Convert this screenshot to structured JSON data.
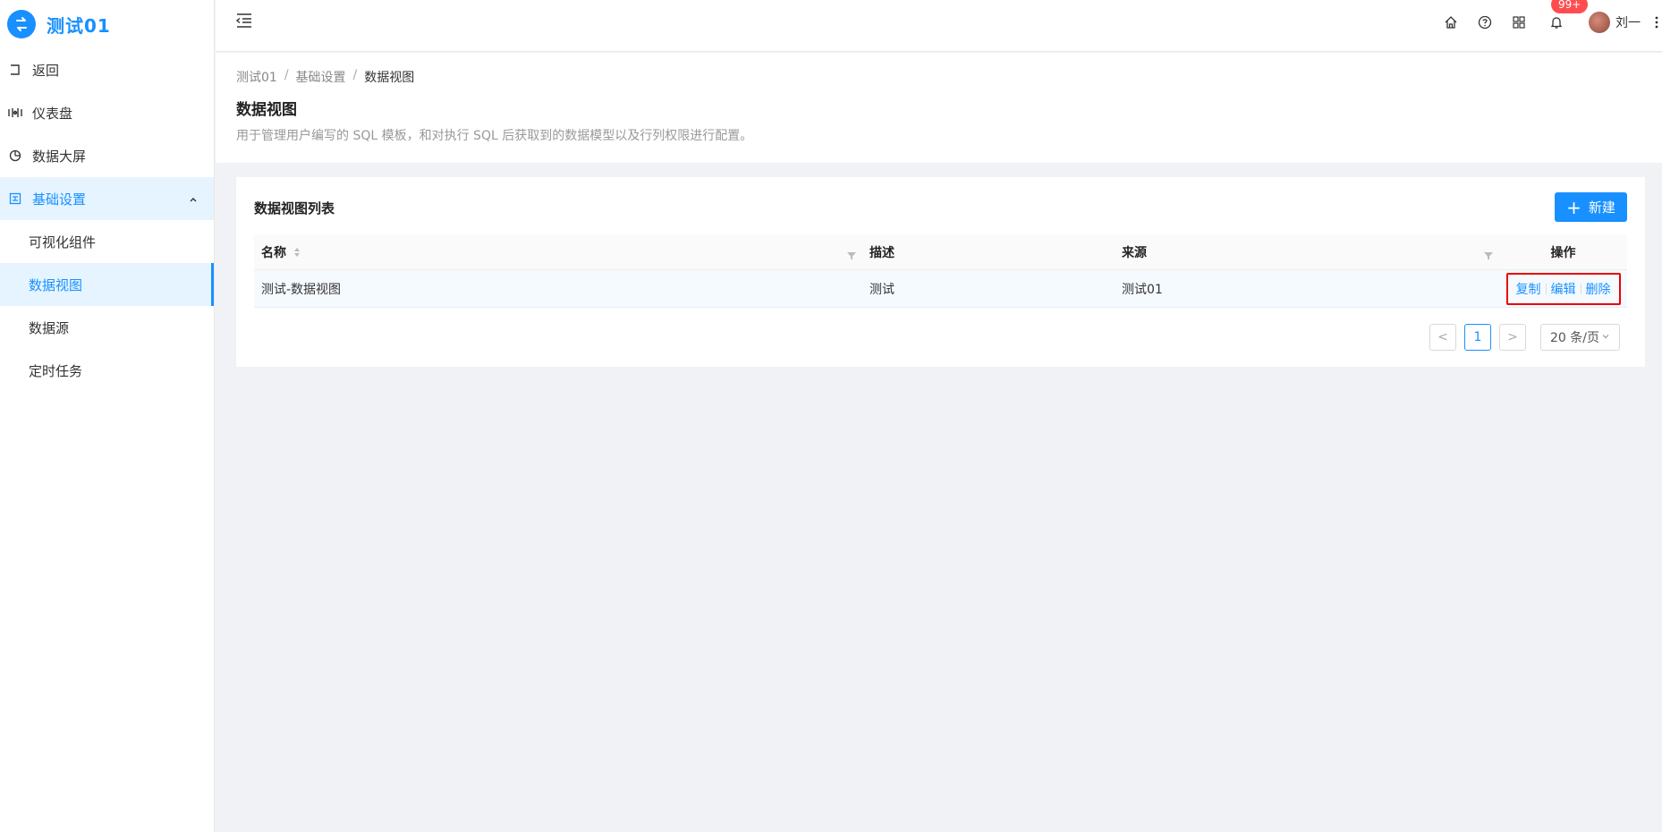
{
  "app": {
    "title": "测试01"
  },
  "sidebar": {
    "items": [
      {
        "label": "返回",
        "icon": "exit-icon"
      },
      {
        "label": "仪表盘",
        "icon": "dashboard-icon"
      },
      {
        "label": "数据大屏",
        "icon": "pie-icon"
      },
      {
        "label": "基础设置",
        "icon": "settings-grid-icon",
        "expanded": true
      }
    ],
    "sub_items": [
      {
        "label": "可视化组件"
      },
      {
        "label": "数据视图",
        "active": true
      },
      {
        "label": "数据源"
      },
      {
        "label": "定时任务"
      }
    ]
  },
  "header": {
    "notification_badge": "99+",
    "username": "刘一"
  },
  "breadcrumb": [
    "测试01",
    "基础设置",
    "数据视图"
  ],
  "page": {
    "title": "数据视图",
    "description": "用于管理用户编写的 SQL 模板，和对执行 SQL 后获取到的数据模型以及行列权限进行配置。"
  },
  "card": {
    "title": "数据视图列表",
    "new_button": "新建"
  },
  "table": {
    "columns": {
      "name": "名称",
      "desc": "描述",
      "source": "来源",
      "actions": "操作"
    },
    "rows": [
      {
        "name": "测试-数据视图",
        "desc": "测试",
        "source": "测试01",
        "actions": [
          "复制",
          "编辑",
          "删除"
        ]
      }
    ]
  },
  "pagination": {
    "prev": "<",
    "current_page": "1",
    "next": ">",
    "page_size": "20 条/页"
  },
  "colors": {
    "primary": "#1890ff",
    "badge": "#ff4d4f",
    "highlight_border": "#e00000"
  }
}
